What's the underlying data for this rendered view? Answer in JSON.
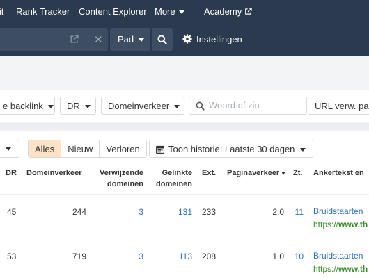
{
  "nav": {
    "items": [
      {
        "label": "lit"
      },
      {
        "label": "Rank Tracker"
      },
      {
        "label": "Content Explorer"
      },
      {
        "label": "More"
      },
      {
        "label": "Academy"
      }
    ]
  },
  "searchbar": {
    "mode_select": "Pad",
    "settings_label": "Instellingen"
  },
  "filters": {
    "backlink_dropdown": "e backlink",
    "dr_dropdown": "DR",
    "traffic_dropdown": "Domeinverkeer",
    "search_placeholder": "Woord of zin",
    "url_dropdown": "URL verw. pag"
  },
  "toolbar": {
    "segments": [
      "Alles",
      "Nieuw",
      "Verloren"
    ],
    "active_segment": "Alles",
    "history_label": "Toon historie: Laatste 30 dagen"
  },
  "table": {
    "headers": {
      "dr": "DR",
      "domain_traffic": "Domeinverkeer",
      "referring_1": "Verwijzende",
      "referring_2": "domeinen",
      "linked_1": "Gelinkte",
      "linked_2": "domeinen",
      "ext": "Ext.",
      "page_traffic": "Paginaverkeer",
      "kw": "Zt.",
      "anchor": "Ankertekst en"
    },
    "rows": [
      {
        "dr": "45",
        "domain_traffic": "244",
        "referring": "3",
        "linked": "131",
        "ext": "233",
        "page_traffic": "2.0",
        "kw": "11",
        "anchor_text": "Bruidstaarten",
        "anchor_url_prefix": "https://",
        "anchor_url_bold": "www.th"
      },
      {
        "dr": "53",
        "domain_traffic": "719",
        "referring": "3",
        "linked": "113",
        "ext": "208",
        "page_traffic": "1.0",
        "kw": "10",
        "anchor_text": "Bruidstaarten",
        "anchor_url_prefix": "https://",
        "anchor_url_bold": "www.th"
      }
    ]
  },
  "colors": {
    "nav_bg": "#2b3a4e",
    "active_segment": "#fde3c6",
    "link": "#2d6fb7",
    "url_green": "#3b8d2c"
  }
}
